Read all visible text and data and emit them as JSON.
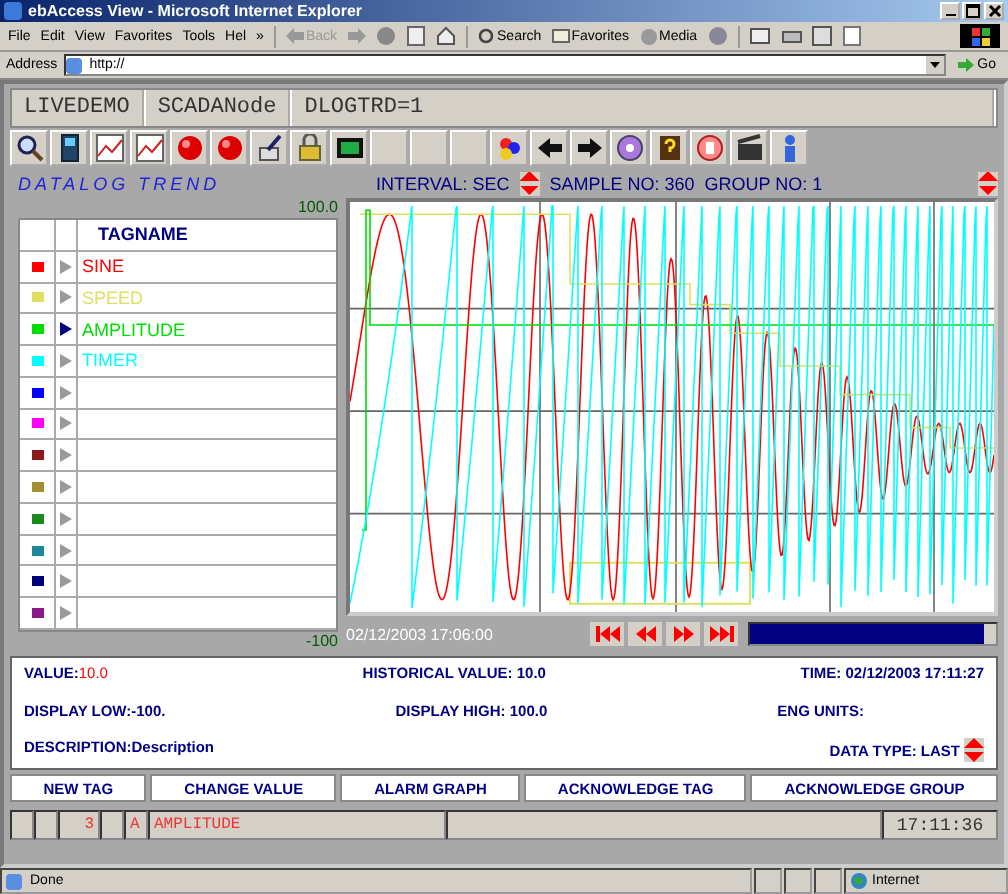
{
  "window": {
    "title": "ebAccess View - Microsoft Internet Explorer"
  },
  "menu": [
    "File",
    "Edit",
    "View",
    "Favorites",
    "Tools",
    "Hel"
  ],
  "menu_overflow": "»",
  "toolbar": {
    "back": "Back",
    "search": "Search",
    "favorites": "Favorites",
    "media": "Media"
  },
  "address": {
    "label": "Address",
    "value": "http://",
    "go": "Go"
  },
  "header": {
    "project": "LIVEDEMO",
    "node": "SCADANode",
    "display": "DLOGTRD=1"
  },
  "trend": {
    "title": "DATALOG TREND",
    "interval": "INTERVAL: SEC",
    "sample": "SAMPLE NO: 360",
    "group": "GROUP NO: 1",
    "y_max": "100.0",
    "y_min": "-100",
    "timestamp": "02/12/2003 17:06:00",
    "scroll": {
      "level": 0.95
    }
  },
  "tag_table": {
    "header": "TAGNAME",
    "rows": [
      {
        "color": "#ff0000",
        "name": "SINE",
        "selected": false
      },
      {
        "color": "#e0e060",
        "name": "SPEED",
        "selected": false
      },
      {
        "color": "#00dd00",
        "name": "AMPLITUDE",
        "selected": true
      },
      {
        "color": "#00ffff",
        "name": "TIMER",
        "selected": false
      },
      {
        "color": "#0000ff",
        "selected": false
      },
      {
        "color": "#ff00ff",
        "selected": false
      },
      {
        "color": "#8b1a1a",
        "selected": false
      },
      {
        "color": "#a09030",
        "selected": false
      },
      {
        "color": "#1a8a1a",
        "selected": false
      },
      {
        "color": "#1a8a9a",
        "selected": false
      },
      {
        "color": "#00007a",
        "selected": false
      },
      {
        "color": "#8a1a8a",
        "selected": false
      }
    ]
  },
  "info": {
    "value_label": "VALUE:",
    "value": "10.0",
    "historical": "HISTORICAL VALUE: 10.0",
    "time": "TIME:  02/12/2003 17:11:27",
    "display_low": "DISPLAY LOW:-100.",
    "display_high": "DISPLAY HIGH:  100.0",
    "eng_units": "ENG UNITS:",
    "description": "DESCRIPTION:Description",
    "data_type": "DATA TYPE: LAST"
  },
  "buttons": [
    "NEW TAG",
    "CHANGE VALUE",
    "ALARM GRAPH",
    "ACKNOWLEDGE TAG",
    "ACKNOWLEDGE GROUP"
  ],
  "alarm_bar": {
    "count": "3",
    "type": "A",
    "tag": "AMPLITUDE",
    "clock": "17:11:36"
  },
  "status_bar": {
    "text": "Done",
    "zone": "Internet"
  }
}
